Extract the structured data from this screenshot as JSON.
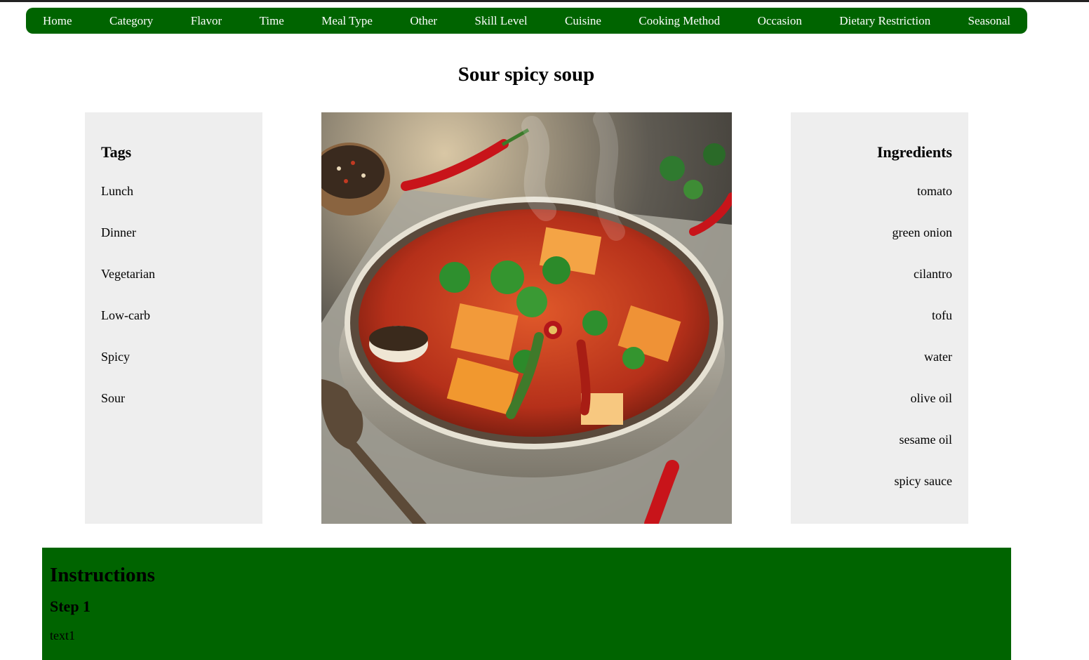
{
  "nav": {
    "items": [
      "Home",
      "Category",
      "Flavor",
      "Time",
      "Meal Type",
      "Other",
      "Skill Level",
      "Cuisine",
      "Cooking Method",
      "Occasion",
      "Dietary Restriction",
      "Seasonal"
    ]
  },
  "recipe": {
    "title": "Sour spicy soup"
  },
  "tags": {
    "heading": "Tags",
    "items": [
      "Lunch",
      "Dinner",
      "Vegetarian",
      "Low-carb",
      "Spicy",
      "Sour"
    ]
  },
  "ingredients": {
    "heading": "Ingredients",
    "items": [
      "tomato",
      "green onion",
      "cilantro",
      "tofu",
      "water",
      "olive oil",
      "sesame oil",
      "spicy sauce"
    ]
  },
  "instructions": {
    "heading": "Instructions",
    "steps": [
      {
        "title": "Step 1",
        "text": "text1"
      }
    ]
  },
  "colors": {
    "nav_bg": "#006400",
    "panel_bg": "#eeeeee",
    "instructions_bg": "#006400"
  }
}
